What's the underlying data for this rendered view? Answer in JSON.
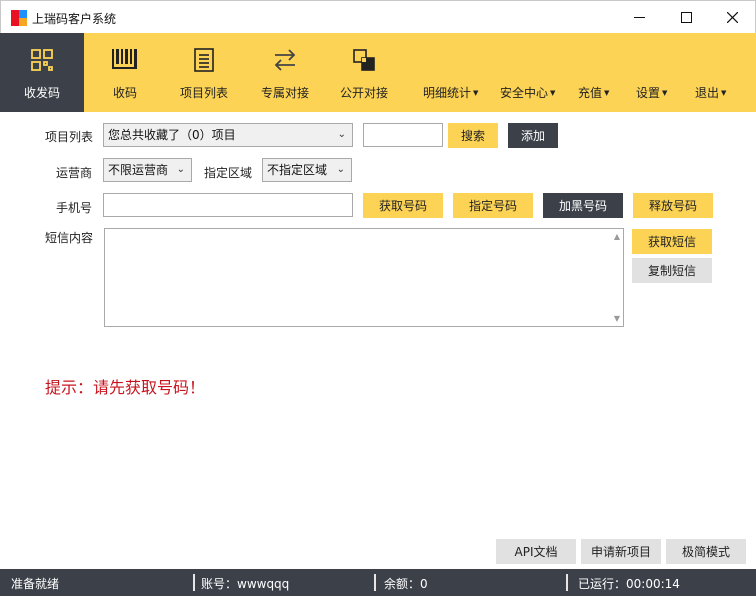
{
  "window": {
    "title": "上瑞码客户系统",
    "min_glyph": "—",
    "max_glyph": "☐",
    "close_glyph": "✕"
  },
  "toolbar": {
    "items": [
      {
        "label": "收发码",
        "icon": "qr-scan-icon",
        "active": true
      },
      {
        "label": "收码",
        "icon": "barcode-icon",
        "active": false
      },
      {
        "label": "项目列表",
        "icon": "list-document-icon",
        "active": false
      },
      {
        "label": "专属对接",
        "icon": "swap-arrows-icon",
        "active": false
      },
      {
        "label": "公开对接",
        "icon": "link-squares-icon",
        "active": false
      }
    ],
    "menus": [
      {
        "label": "明细统计"
      },
      {
        "label": "安全中心"
      },
      {
        "label": "充值"
      },
      {
        "label": "设置"
      },
      {
        "label": "退出"
      }
    ],
    "caret": "▼"
  },
  "form": {
    "project_label": "项目列表",
    "project_select": "您总共收藏了（0）项目",
    "search_value": "",
    "search_button": "搜索",
    "add_button": "添加",
    "operator_label": "运营商",
    "operator_select": "不限运营商",
    "region_label": "指定区域",
    "region_select": "不指定区域",
    "phone_label": "手机号",
    "phone_value": "",
    "get_number_button": "获取号码",
    "specify_number_button": "指定号码",
    "blacklist_button": "加黑号码",
    "release_button": "释放号码",
    "sms_label": "短信内容",
    "sms_value": "",
    "get_sms_button": "获取短信",
    "copy_sms_button": "复制短信",
    "arrow_glyph": "⌄",
    "scroll_up_glyph": "▲",
    "scroll_down_glyph": "▼"
  },
  "hint": "提示：请先获取号码！",
  "bottom_buttons": {
    "api_docs": "API文档",
    "apply_project": "申请新项目",
    "simple_mode": "极简模式"
  },
  "status": {
    "ready": "准备就绪",
    "account": "账号：wwwqqq",
    "balance": "余额：0",
    "uptime": "已运行：00:00:14"
  },
  "colors": {
    "accent_yellow": "#fcd354",
    "dark": "#3c4149",
    "hint_red": "#c8141e"
  }
}
